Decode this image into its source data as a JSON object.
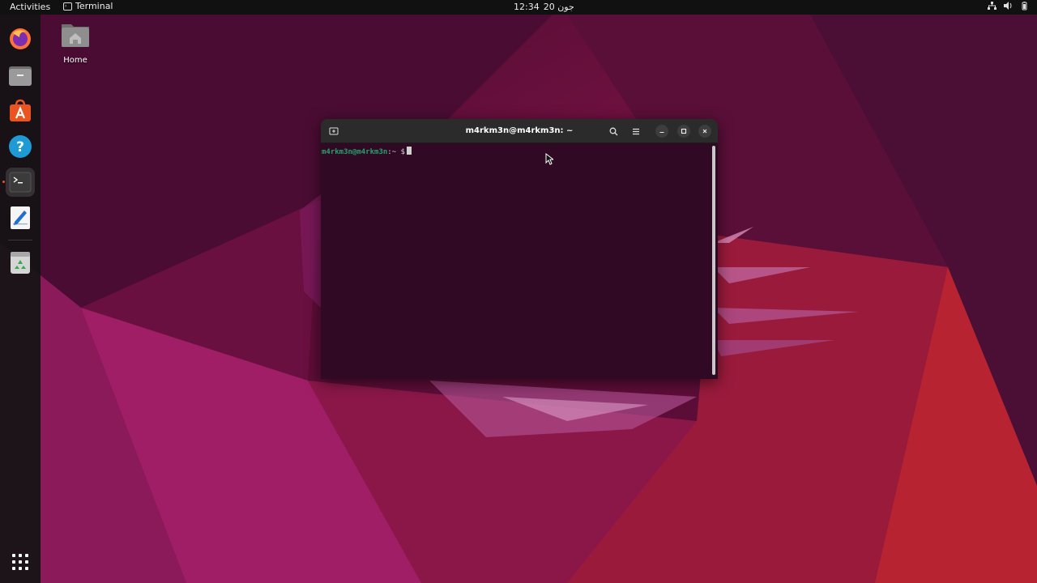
{
  "topbar": {
    "activities_label": "Activities",
    "app_name": "Terminal",
    "clock_time": "12:34",
    "clock_date": "20 جون",
    "tray_icons": [
      "network-icon",
      "volume-icon",
      "battery-icon"
    ]
  },
  "dock": {
    "items": [
      {
        "name": "firefox",
        "icon": "firefox-icon"
      },
      {
        "name": "files",
        "icon": "files-icon"
      },
      {
        "name": "app-center",
        "icon": "app-center-icon"
      },
      {
        "name": "help",
        "icon": "help-icon"
      },
      {
        "name": "terminal",
        "icon": "terminal-icon",
        "running": true
      },
      {
        "name": "text-editor",
        "icon": "text-editor-icon"
      },
      {
        "name": "trash",
        "icon": "trash-icon"
      }
    ],
    "show_apps_icon": "show-apps-grid-icon"
  },
  "desktop": {
    "home_label": "Home"
  },
  "terminal": {
    "title": "m4rkm3n@m4rkm3n: ~",
    "prompt_user": "m4rkm3n@m4rkm3n",
    "prompt_path": ":~",
    "prompt_symbol": "$",
    "colors": {
      "background": "#300a24",
      "user": "#26a269",
      "text": "#d0d0d0"
    }
  },
  "colors": {
    "accent": "#e95420",
    "topbar": "#111111"
  }
}
